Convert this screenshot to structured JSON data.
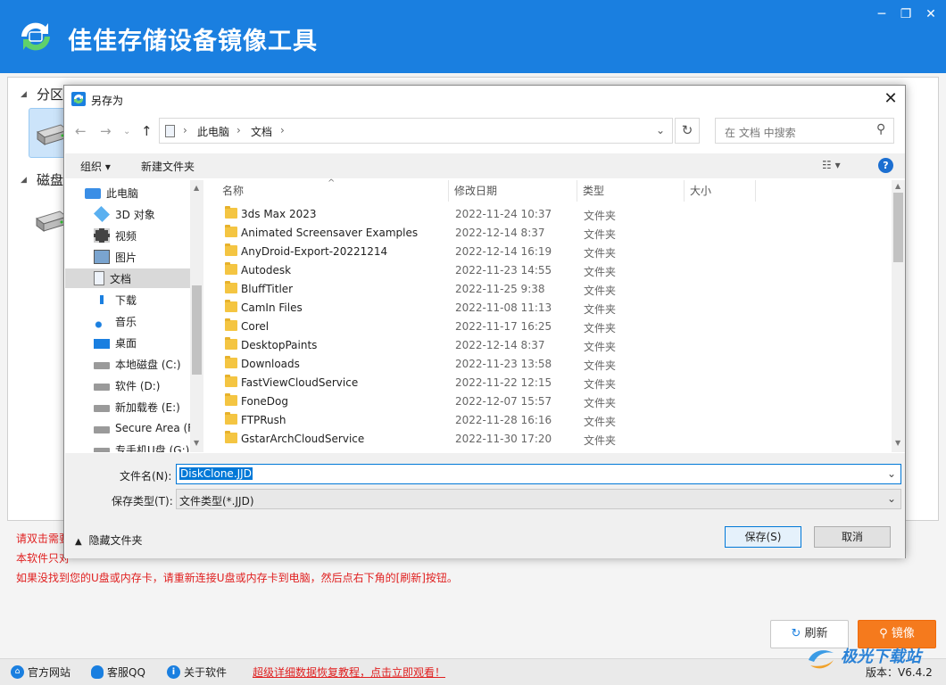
{
  "app": {
    "title": "佳佳存储设备镜像工具",
    "brand_color": "#1a7fe0",
    "window_controls": [
      "─",
      "❐",
      "✕"
    ]
  },
  "main": {
    "section_partition": "分区",
    "section_disk": "磁盘",
    "hints": [
      "请双击需要",
      "本软件只对",
      "如果没找到您的U盘或内存卡，请重新连接U盘或内存卡到电脑，然后点右下角的[刷新]按钮。"
    ],
    "refresh_label": "刷新",
    "mirror_label": "镜像",
    "accent_color": "#f57a1d"
  },
  "footer": {
    "website": "官方网站",
    "qq": "客服QQ",
    "about": "关于软件",
    "promo": "超级详细数据恢复教程，点击立即观看！",
    "version": "版本：V6.4.2"
  },
  "watermark": {
    "text": "极光下载站"
  },
  "dialog": {
    "title": "另存为",
    "address": {
      "root": "此电脑",
      "folder": "文档"
    },
    "search_placeholder": "在 文档 中搜索",
    "toolbar": {
      "organize": "组织 ▾",
      "new_folder": "新建文件夹"
    },
    "nav_items": [
      {
        "label": "此电脑",
        "icon": "computer-icon"
      },
      {
        "label": "3D 对象",
        "icon": "cube-icon"
      },
      {
        "label": "视频",
        "icon": "video-icon"
      },
      {
        "label": "图片",
        "icon": "picture-icon"
      },
      {
        "label": "文档",
        "icon": "document-icon"
      },
      {
        "label": "下载",
        "icon": "download-icon"
      },
      {
        "label": "音乐",
        "icon": "music-icon"
      },
      {
        "label": "桌面",
        "icon": "desktop-icon"
      },
      {
        "label": "本地磁盘 (C:)",
        "icon": "drive-icon"
      },
      {
        "label": "软件 (D:)",
        "icon": "drive-icon"
      },
      {
        "label": "新加载卷 (E:)",
        "icon": "drive-icon"
      },
      {
        "label": "Secure Area (F:",
        "icon": "drive-icon"
      },
      {
        "label": "专手机U盘 (G:)",
        "icon": "drive-icon"
      }
    ],
    "columns": [
      "名称",
      "修改日期",
      "类型",
      "大小"
    ],
    "files": [
      {
        "name": "3ds Max 2023",
        "date": "2022-11-24 10:37",
        "type": "文件夹"
      },
      {
        "name": "Animated Screensaver Examples",
        "date": "2022-12-14 8:37",
        "type": "文件夹"
      },
      {
        "name": "AnyDroid-Export-20221214",
        "date": "2022-12-14 16:19",
        "type": "文件夹"
      },
      {
        "name": "Autodesk",
        "date": "2022-11-23 14:55",
        "type": "文件夹"
      },
      {
        "name": "BluffTitler",
        "date": "2022-11-25 9:38",
        "type": "文件夹"
      },
      {
        "name": "CamIn Files",
        "date": "2022-11-08 11:13",
        "type": "文件夹"
      },
      {
        "name": "Corel",
        "date": "2022-11-17 16:25",
        "type": "文件夹"
      },
      {
        "name": "DesktopPaints",
        "date": "2022-12-14 8:37",
        "type": "文件夹"
      },
      {
        "name": "Downloads",
        "date": "2022-11-23 13:58",
        "type": "文件夹"
      },
      {
        "name": "FastViewCloudService",
        "date": "2022-11-22 12:15",
        "type": "文件夹"
      },
      {
        "name": "FoneDog",
        "date": "2022-12-07 15:57",
        "type": "文件夹"
      },
      {
        "name": "FTPRush",
        "date": "2022-11-28 16:16",
        "type": "文件夹"
      },
      {
        "name": "GstarArchCloudService",
        "date": "2022-11-30 17:20",
        "type": "文件夹"
      }
    ],
    "filename_label": "文件名(N):",
    "filename_value": "DiskClone.JJD",
    "filetype_label": "保存类型(T):",
    "filetype_value": "文件类型(*.JJD)",
    "hide_folders": "隐藏文件夹",
    "save_label": "保存(S)",
    "cancel_label": "取消"
  }
}
